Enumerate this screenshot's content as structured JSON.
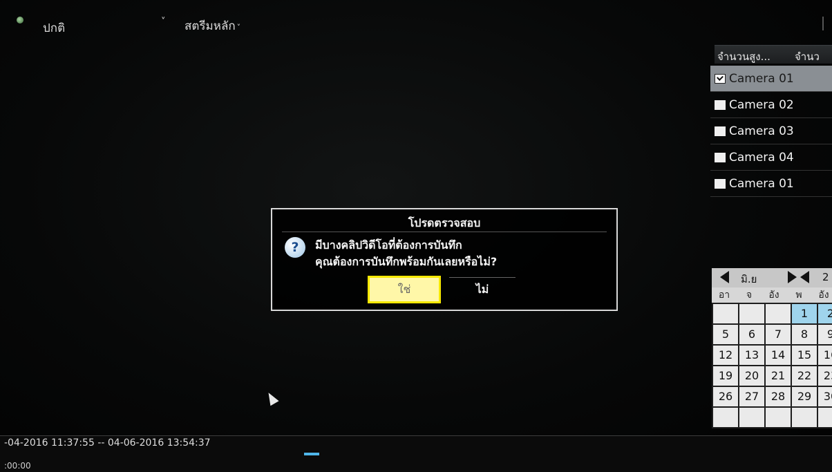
{
  "top_bar": {
    "mode_label": "ปกติ",
    "mode_chevron": "˅",
    "stream_label": "สตรีมหลัก",
    "stream_chevron": "˅"
  },
  "camera_panel": {
    "columns": [
      "จำนวนสูง...",
      "จำนว"
    ],
    "items": [
      {
        "label": "Camera 01",
        "checked": true
      },
      {
        "label": "Camera 02",
        "checked": false
      },
      {
        "label": "Camera 03",
        "checked": false
      },
      {
        "label": "Camera 04",
        "checked": false
      },
      {
        "label": "Camera 01",
        "checked": false
      }
    ]
  },
  "calendar": {
    "month": "มิ.ย",
    "year_partial": "2",
    "weekdays": [
      "อา",
      "จ",
      "อัง",
      "พ",
      "อัง"
    ],
    "rows": [
      [
        "",
        "",
        "",
        "1",
        "2"
      ],
      [
        "5",
        "6",
        "7",
        "8",
        "9"
      ],
      [
        "12",
        "13",
        "14",
        "15",
        "16"
      ],
      [
        "19",
        "20",
        "21",
        "22",
        "23"
      ],
      [
        "26",
        "27",
        "28",
        "29",
        "30"
      ],
      [
        "",
        "",
        "",
        "",
        ""
      ]
    ],
    "highlighted": [
      "1",
      "2"
    ]
  },
  "dialog": {
    "title": "โปรดตรวจสอบ",
    "icon": "question-icon",
    "message_line1": "มีบางคลิปวิดีโอที่ต้องการบันทึก",
    "message_line2": "คุณต้องการบันทึกพร้อมกันเลยหรือไม่?",
    "yes_label": "ใช่",
    "no_label": "ไม่"
  },
  "timeline": {
    "range_text": "-04-2016 11:37:55 -- 04-06-2016 13:54:37",
    "counter_text": ":00:00"
  },
  "colors": {
    "accent_yellow": "#f5e800",
    "timeline_marker": "#4fb6ea",
    "today_highlight": "#9fd4ec"
  }
}
